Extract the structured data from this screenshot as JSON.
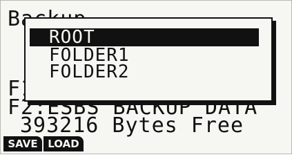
{
  "background_screen": {
    "title": "Backup",
    "line1": "F1",
    "line2": "F2:ESBS BACKUP DATA",
    "free_space": "393216 Bytes Free"
  },
  "popup": {
    "items": [
      {
        "label": "ROOT",
        "selected": true
      },
      {
        "label": "FOLDER1",
        "selected": false
      },
      {
        "label": "FOLDER2",
        "selected": false
      }
    ]
  },
  "function_keys": {
    "f1": "SAVE",
    "f2": "LOAD"
  },
  "colors": {
    "lcd_background": "#f6f6f2",
    "lcd_ink": "#111111"
  }
}
